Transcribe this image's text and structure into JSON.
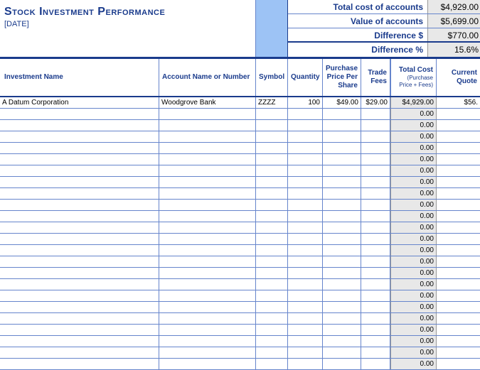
{
  "title": "Stock Investment Performance",
  "date_placeholder": "[DATE]",
  "summary": {
    "total_cost_label": "Total cost of accounts",
    "total_cost_value": "$4,929.00",
    "value_label": "Value of accounts",
    "value_value": "$5,699.00",
    "diff_dollar_label": "Difference $",
    "diff_dollar_value": "$770.00",
    "diff_pct_label": "Difference %",
    "diff_pct_value": "15.6%"
  },
  "columns": {
    "c1": "Investment Name",
    "c2": "Account Name or Number",
    "c3": "Symbol",
    "c4": "Quantity",
    "c5": "Purchase Price Per Share",
    "c6": "Trade Fees",
    "c7": "Total Cost",
    "c7_sub": "(Purchase Price + Fees)",
    "c8": "Current Quote"
  },
  "rows": [
    {
      "c1": "A Datum Corporation",
      "c2": "Woodgrove Bank",
      "c3": "ZZZZ",
      "c4": "100",
      "c5": "$49.00",
      "c6": "$29.00",
      "c7": "$4,929.00",
      "c8": "$56."
    },
    {
      "c1": "",
      "c2": "",
      "c3": "",
      "c4": "",
      "c5": "",
      "c6": "",
      "c7": "0.00",
      "c8": ""
    },
    {
      "c1": "",
      "c2": "",
      "c3": "",
      "c4": "",
      "c5": "",
      "c6": "",
      "c7": "0.00",
      "c8": ""
    },
    {
      "c1": "",
      "c2": "",
      "c3": "",
      "c4": "",
      "c5": "",
      "c6": "",
      "c7": "0.00",
      "c8": ""
    },
    {
      "c1": "",
      "c2": "",
      "c3": "",
      "c4": "",
      "c5": "",
      "c6": "",
      "c7": "0.00",
      "c8": ""
    },
    {
      "c1": "",
      "c2": "",
      "c3": "",
      "c4": "",
      "c5": "",
      "c6": "",
      "c7": "0.00",
      "c8": ""
    },
    {
      "c1": "",
      "c2": "",
      "c3": "",
      "c4": "",
      "c5": "",
      "c6": "",
      "c7": "0.00",
      "c8": ""
    },
    {
      "c1": "",
      "c2": "",
      "c3": "",
      "c4": "",
      "c5": "",
      "c6": "",
      "c7": "0.00",
      "c8": ""
    },
    {
      "c1": "",
      "c2": "",
      "c3": "",
      "c4": "",
      "c5": "",
      "c6": "",
      "c7": "0.00",
      "c8": ""
    },
    {
      "c1": "",
      "c2": "",
      "c3": "",
      "c4": "",
      "c5": "",
      "c6": "",
      "c7": "0.00",
      "c8": ""
    },
    {
      "c1": "",
      "c2": "",
      "c3": "",
      "c4": "",
      "c5": "",
      "c6": "",
      "c7": "0.00",
      "c8": ""
    },
    {
      "c1": "",
      "c2": "",
      "c3": "",
      "c4": "",
      "c5": "",
      "c6": "",
      "c7": "0.00",
      "c8": ""
    },
    {
      "c1": "",
      "c2": "",
      "c3": "",
      "c4": "",
      "c5": "",
      "c6": "",
      "c7": "0.00",
      "c8": ""
    },
    {
      "c1": "",
      "c2": "",
      "c3": "",
      "c4": "",
      "c5": "",
      "c6": "",
      "c7": "0.00",
      "c8": ""
    },
    {
      "c1": "",
      "c2": "",
      "c3": "",
      "c4": "",
      "c5": "",
      "c6": "",
      "c7": "0.00",
      "c8": ""
    },
    {
      "c1": "",
      "c2": "",
      "c3": "",
      "c4": "",
      "c5": "",
      "c6": "",
      "c7": "0.00",
      "c8": ""
    },
    {
      "c1": "",
      "c2": "",
      "c3": "",
      "c4": "",
      "c5": "",
      "c6": "",
      "c7": "0.00",
      "c8": ""
    },
    {
      "c1": "",
      "c2": "",
      "c3": "",
      "c4": "",
      "c5": "",
      "c6": "",
      "c7": "0.00",
      "c8": ""
    },
    {
      "c1": "",
      "c2": "",
      "c3": "",
      "c4": "",
      "c5": "",
      "c6": "",
      "c7": "0.00",
      "c8": ""
    },
    {
      "c1": "",
      "c2": "",
      "c3": "",
      "c4": "",
      "c5": "",
      "c6": "",
      "c7": "0.00",
      "c8": ""
    },
    {
      "c1": "",
      "c2": "",
      "c3": "",
      "c4": "",
      "c5": "",
      "c6": "",
      "c7": "0.00",
      "c8": ""
    },
    {
      "c1": "",
      "c2": "",
      "c3": "",
      "c4": "",
      "c5": "",
      "c6": "",
      "c7": "0.00",
      "c8": ""
    },
    {
      "c1": "",
      "c2": "",
      "c3": "",
      "c4": "",
      "c5": "",
      "c6": "",
      "c7": "0.00",
      "c8": ""
    },
    {
      "c1": "",
      "c2": "",
      "c3": "",
      "c4": "",
      "c5": "",
      "c6": "",
      "c7": "0.00",
      "c8": ""
    }
  ]
}
